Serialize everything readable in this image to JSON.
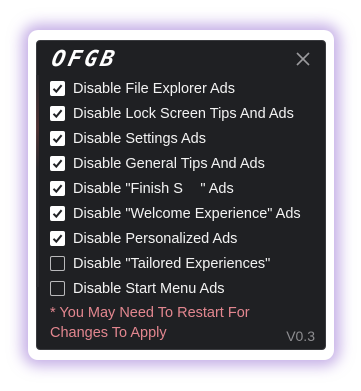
{
  "app": {
    "logo_text": "OFGB",
    "version": "V0.3",
    "close_icon": "close-icon"
  },
  "options": [
    {
      "label": "Disable File Explorer Ads",
      "checked": true
    },
    {
      "label": "Disable Lock Screen Tips And Ads",
      "checked": true
    },
    {
      "label": "Disable Settings Ads",
      "checked": true
    },
    {
      "label": "Disable General Tips And Ads",
      "checked": true
    },
    {
      "label": "Disable \"Finish S      \" Ads",
      "checked": true
    },
    {
      "label": "Disable \"Welcome Experience\" Ads",
      "checked": true
    },
    {
      "label": "Disable Personalized Ads",
      "checked": true
    },
    {
      "label": "Disable \"Tailored Experiences\"",
      "checked": false
    },
    {
      "label": "Disable Start Menu Ads",
      "checked": false
    }
  ],
  "note": "* You May Need To Restart For Changes To Apply",
  "colors": {
    "window_bg": "#1f2023",
    "note_text": "#e2868f",
    "glow": "#966ed2"
  }
}
